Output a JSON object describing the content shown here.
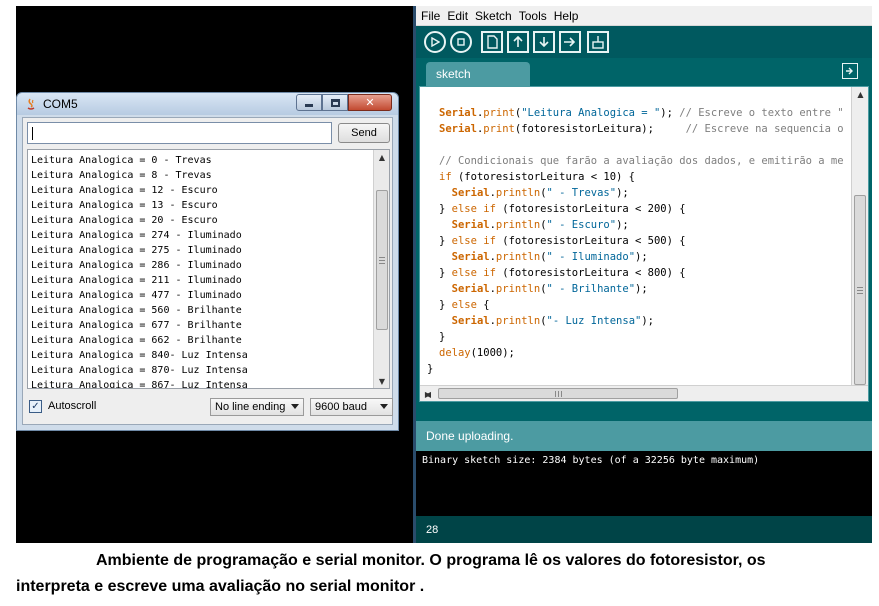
{
  "serial_monitor": {
    "title": "COM5",
    "input_value": "",
    "send_label": "Send",
    "output_lines": [
      "Leitura Analogica = 0 - Trevas",
      "Leitura Analogica = 8 - Trevas",
      "Leitura Analogica = 12 - Escuro",
      "Leitura Analogica = 13 - Escuro",
      "Leitura Analogica = 20 - Escuro",
      "Leitura Analogica = 274 - Iluminado",
      "Leitura Analogica = 275 - Iluminado",
      "Leitura Analogica = 286 - Iluminado",
      "Leitura Analogica = 211 - Iluminado",
      "Leitura Analogica = 477 - Iluminado",
      "Leitura Analogica = 560 - Brilhante",
      "Leitura Analogica = 677 - Brilhante",
      "Leitura Analogica = 662 - Brilhante",
      "Leitura Analogica = 840- Luz Intensa",
      "Leitura Analogica = 870- Luz Intensa",
      "Leitura Analogica = 867- Luz Intensa"
    ],
    "autoscroll_label": "Autoscroll",
    "autoscroll_checked": true,
    "line_ending": "No line ending",
    "baud_rate": "9600 baud"
  },
  "ide": {
    "menu": [
      "File",
      "Edit",
      "Sketch",
      "Tools",
      "Help"
    ],
    "toolbar_icons": [
      "verify-icon",
      "stop-icon",
      "new-icon",
      "open-icon",
      "save-icon",
      "upload-icon",
      "serial-monitor-icon"
    ],
    "tab_label": "sketch",
    "code_lines": [
      [
        {
          "c": "kw",
          "t": "Serial"
        },
        {
          "c": "",
          "t": "."
        },
        {
          "c": "kw2",
          "t": "print"
        },
        {
          "c": "",
          "t": "("
        },
        {
          "c": "str",
          "t": "\"Leitura Analogica = \""
        },
        {
          "c": "",
          "t": "); "
        },
        {
          "c": "cmt",
          "t": "// Escreve o texto entre \""
        }
      ],
      [
        {
          "c": "kw",
          "t": "Serial"
        },
        {
          "c": "",
          "t": "."
        },
        {
          "c": "kw2",
          "t": "print"
        },
        {
          "c": "",
          "t": "(fotoresistorLeitura);     "
        },
        {
          "c": "cmt",
          "t": "// Escreve na sequencia o"
        }
      ],
      [
        {
          "c": "",
          "t": ""
        }
      ],
      [
        {
          "c": "cmt",
          "t": "// Condicionais que farão a avaliação dos dados, e emitirão a me"
        }
      ],
      [
        {
          "c": "kw2",
          "t": "if"
        },
        {
          "c": "",
          "t": " (fotoresistorLeitura < 10) {"
        }
      ],
      [
        {
          "c": "",
          "t": "  "
        },
        {
          "c": "kw",
          "t": "Serial"
        },
        {
          "c": "",
          "t": "."
        },
        {
          "c": "kw2",
          "t": "println"
        },
        {
          "c": "",
          "t": "("
        },
        {
          "c": "str",
          "t": "\" - Trevas\""
        },
        {
          "c": "",
          "t": ");"
        }
      ],
      [
        {
          "c": "",
          "t": "} "
        },
        {
          "c": "kw2",
          "t": "else if"
        },
        {
          "c": "",
          "t": " (fotoresistorLeitura < 200) {"
        }
      ],
      [
        {
          "c": "",
          "t": "  "
        },
        {
          "c": "kw",
          "t": "Serial"
        },
        {
          "c": "",
          "t": "."
        },
        {
          "c": "kw2",
          "t": "println"
        },
        {
          "c": "",
          "t": "("
        },
        {
          "c": "str",
          "t": "\" - Escuro\""
        },
        {
          "c": "",
          "t": ");"
        }
      ],
      [
        {
          "c": "",
          "t": "} "
        },
        {
          "c": "kw2",
          "t": "else if"
        },
        {
          "c": "",
          "t": " (fotoresistorLeitura < 500) {"
        }
      ],
      [
        {
          "c": "",
          "t": "  "
        },
        {
          "c": "kw",
          "t": "Serial"
        },
        {
          "c": "",
          "t": "."
        },
        {
          "c": "kw2",
          "t": "println"
        },
        {
          "c": "",
          "t": "("
        },
        {
          "c": "str",
          "t": "\" - Iluminado\""
        },
        {
          "c": "",
          "t": ");"
        }
      ],
      [
        {
          "c": "",
          "t": "} "
        },
        {
          "c": "kw2",
          "t": "else if"
        },
        {
          "c": "",
          "t": " (fotoresistorLeitura < 800) {"
        }
      ],
      [
        {
          "c": "",
          "t": "  "
        },
        {
          "c": "kw",
          "t": "Serial"
        },
        {
          "c": "",
          "t": "."
        },
        {
          "c": "kw2",
          "t": "println"
        },
        {
          "c": "",
          "t": "("
        },
        {
          "c": "str",
          "t": "\" - Brilhante\""
        },
        {
          "c": "",
          "t": ");"
        }
      ],
      [
        {
          "c": "",
          "t": "} "
        },
        {
          "c": "kw2",
          "t": "else"
        },
        {
          "c": "",
          "t": " {"
        }
      ],
      [
        {
          "c": "",
          "t": "  "
        },
        {
          "c": "kw",
          "t": "Serial"
        },
        {
          "c": "",
          "t": "."
        },
        {
          "c": "kw2",
          "t": "println"
        },
        {
          "c": "",
          "t": "("
        },
        {
          "c": "str",
          "t": "\"- Luz Intensa\""
        },
        {
          "c": "",
          "t": ");"
        }
      ],
      [
        {
          "c": "",
          "t": "}"
        }
      ],
      [
        {
          "c": "kw2",
          "t": "delay"
        },
        {
          "c": "",
          "t": "(1000);"
        }
      ],
      [
        {
          "c": "",
          "t": "}",
          "outdent": true
        }
      ]
    ],
    "status": "Done uploading.",
    "console": "Binary sketch size: 2384 bytes (of a 32256 byte maximum)",
    "line_number": "28",
    "colors": {
      "teal": "#006468",
      "tab": "#4c9ba2",
      "keyword": "#cc6600",
      "string": "#006699",
      "comment": "#7e7e7e"
    }
  },
  "caption": {
    "line1": "Ambiente de programação e serial monitor. O programa lê os valores do fotoresistor, os",
    "line2": "interpreta e escreve uma avaliação no serial monitor ."
  }
}
